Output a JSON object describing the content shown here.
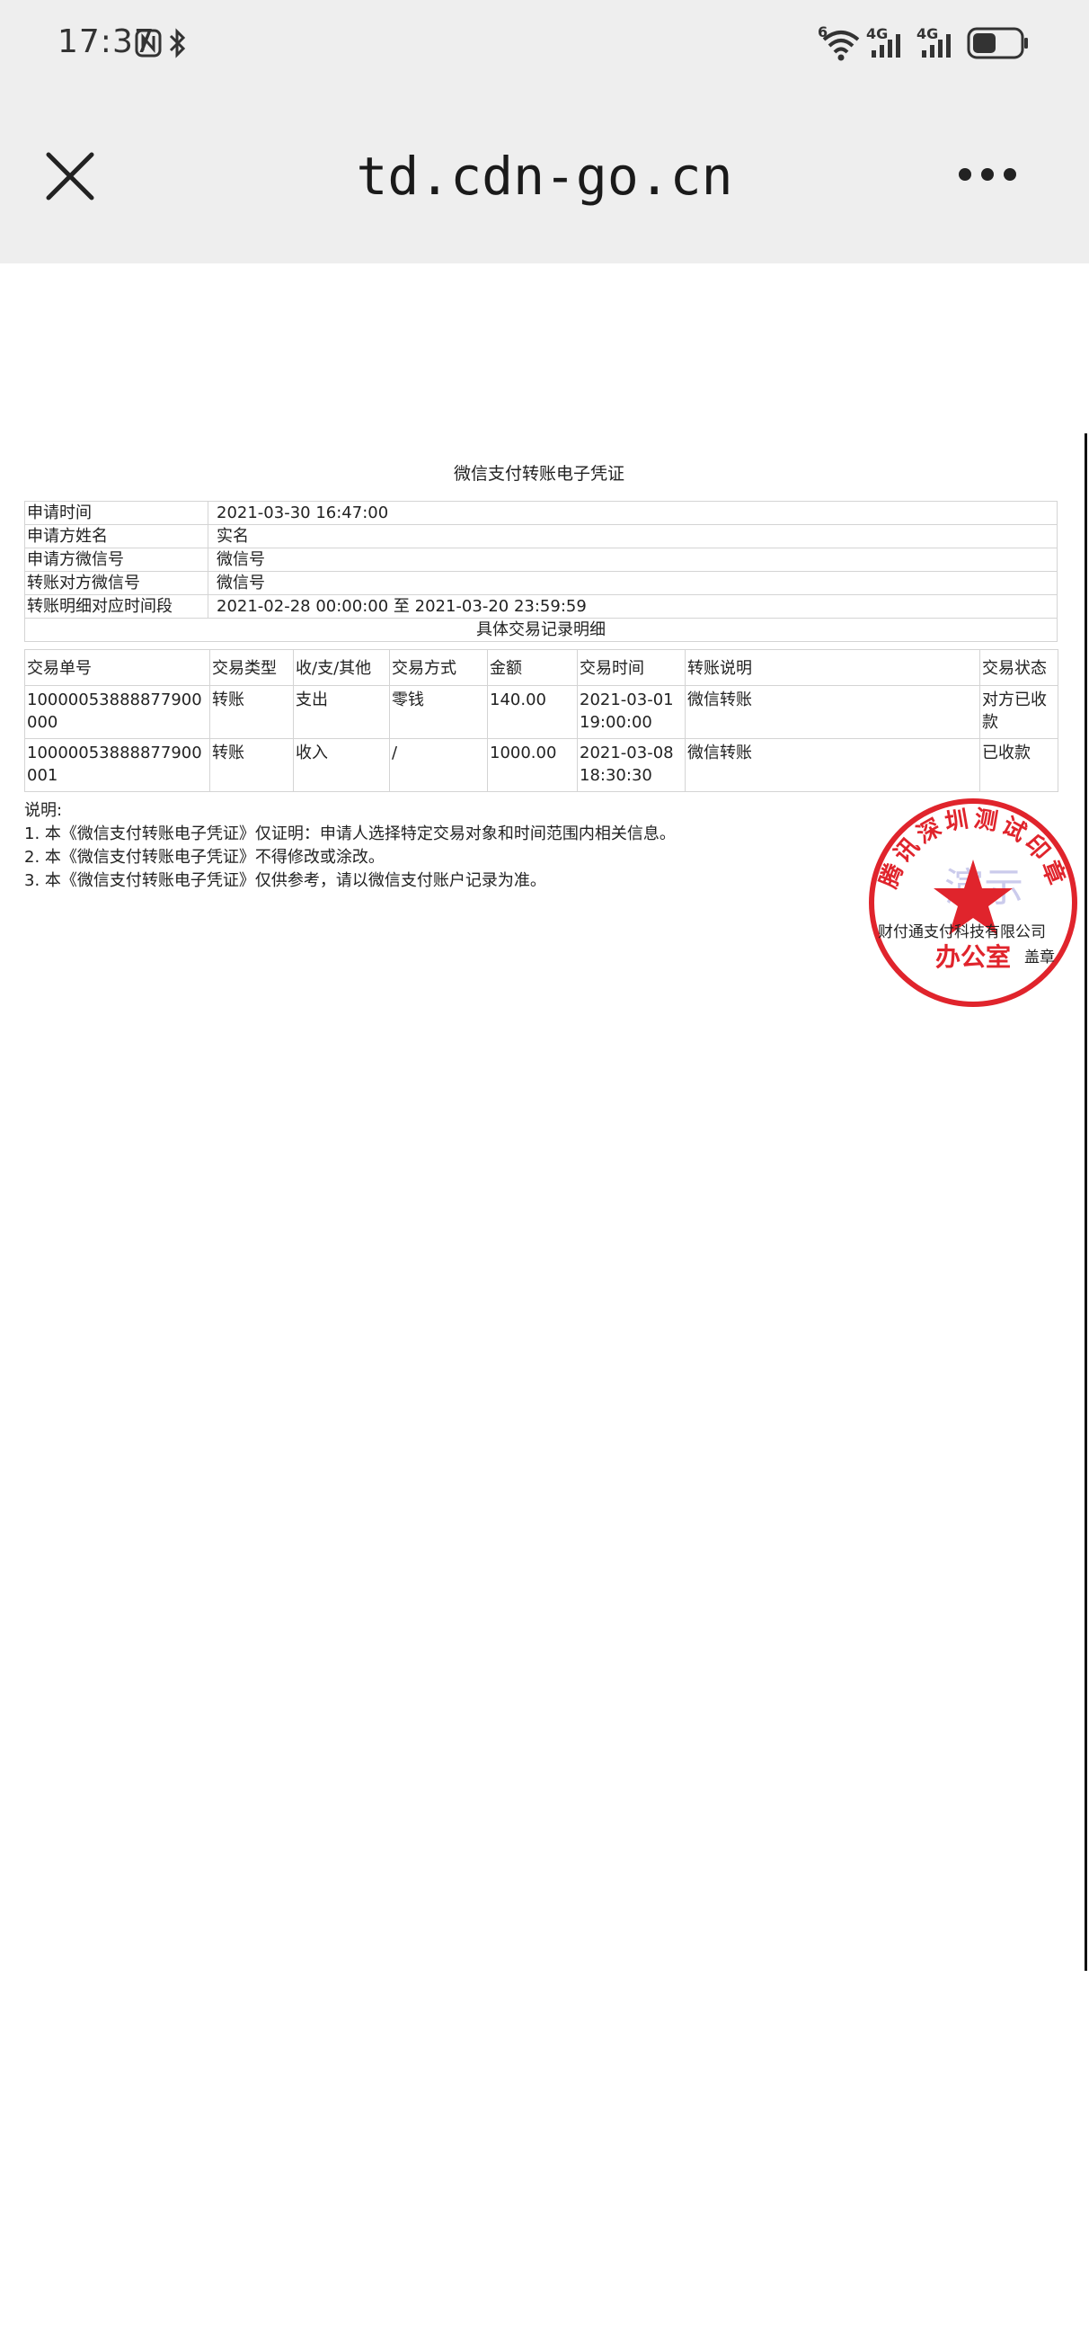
{
  "status_bar": {
    "time": "17:37",
    "icons": [
      "nfc-icon",
      "bluetooth-icon",
      "wifi-icon",
      "signal-4g-icon",
      "signal-4g-icon",
      "battery-icon"
    ],
    "wifi_badge": "6",
    "sim1_label": "4G",
    "sim2_label": "4G",
    "battery_level": 0.5
  },
  "browser": {
    "url_title": "td.cdn-go.cn",
    "close_icon": "close-icon",
    "more_icon": "more-icon"
  },
  "document": {
    "title": "微信支付转账电子凭证",
    "info_rows": [
      {
        "label": "申请时间",
        "value": "2021-03-30 16:47:00"
      },
      {
        "label": "申请方姓名",
        "value": "实名"
      },
      {
        "label": "申请方微信号",
        "value": "微信号"
      },
      {
        "label": "转账对方微信号",
        "value": "微信号"
      },
      {
        "label": "转账明细对应时间段",
        "value": "2021-02-28 00:00:00 至 2021-03-20 23:59:59"
      }
    ],
    "section_title": "具体交易记录明细",
    "columns": [
      "交易单号",
      "交易类型",
      "收/支/其他",
      "交易方式",
      "金额",
      "交易时间",
      "转账说明",
      "交易状态"
    ],
    "rows": [
      [
        "10000053888877900000",
        "转账",
        "支出",
        "零钱",
        "140.00",
        "2021-03-01 19:00:00",
        "微信转账",
        "对方已收款"
      ],
      [
        "10000053888877900001",
        "转账",
        "收入",
        "/",
        "1000.00",
        "2021-03-08 18:30:30",
        "微信转账",
        "已收款"
      ]
    ],
    "notes_title": "说明:",
    "notes": [
      "1. 本《微信支付转账电子凭证》仅证明：申请人选择特定交易对象和时间范围内相关信息。",
      "2. 本《微信支付转账电子凭证》不得修改或涂改。",
      "3. 本《微信支付转账电子凭证》仅供参考，请以微信支付账户记录为准。"
    ]
  },
  "seal": {
    "ring_text": "腾讯深圳测试印章",
    "watermark": "演示",
    "company_text": "财付通支付科技有限公司",
    "office_text": "办公室",
    "stamp_label": "盖章",
    "color": "#e0242c"
  }
}
